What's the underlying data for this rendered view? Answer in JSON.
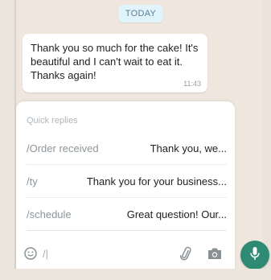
{
  "chat": {
    "date_label": "TODAY",
    "message": {
      "text": "Thank you so much for the cake! It's beautiful and I can't wait to eat it. Thanks again!",
      "time": "11:43"
    }
  },
  "quick_replies": {
    "title": "Quick replies",
    "items": [
      {
        "shortcut": "/Order received",
        "preview": "Thank you, we..."
      },
      {
        "shortcut": "/ty",
        "preview": "Thank you for your business..."
      },
      {
        "shortcut": "/schedule",
        "preview": "Great question! Our..."
      }
    ]
  },
  "composer": {
    "typed_text": "/|"
  },
  "icons": {
    "emoji": "emoji-icon",
    "attach": "paperclip-icon",
    "camera": "camera-icon",
    "mic": "microphone-icon"
  },
  "colors": {
    "accent": "#2e8a72",
    "date_pill_bg": "#e1f3fb",
    "background": "#efe7de"
  }
}
